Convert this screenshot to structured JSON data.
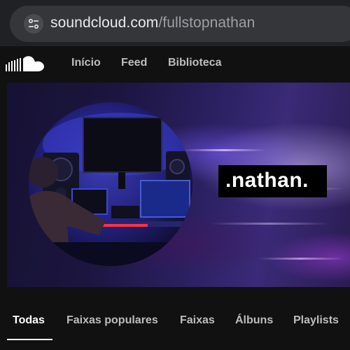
{
  "browser": {
    "url_domain": "soundcloud.com",
    "url_path": "/fullstopnathan",
    "site_info_icon": "tune-icon"
  },
  "header": {
    "logo_icon": "soundcloud-logo-icon",
    "nav": [
      {
        "label": "Início"
      },
      {
        "label": "Feed"
      },
      {
        "label": "Biblioteca"
      }
    ]
  },
  "profile": {
    "name": ".nathan.",
    "avatar": "studio-photo"
  },
  "tabs": {
    "active_index": 0,
    "items": [
      {
        "label": "Todas"
      },
      {
        "label": "Faixas populares"
      },
      {
        "label": "Faixas"
      },
      {
        "label": "Álbuns"
      },
      {
        "label": "Playlists"
      }
    ]
  },
  "colors": {
    "background": "#111111",
    "browser_bar": "#202124",
    "text_primary": "#ffffff",
    "text_secondary": "#bdbdbd"
  }
}
